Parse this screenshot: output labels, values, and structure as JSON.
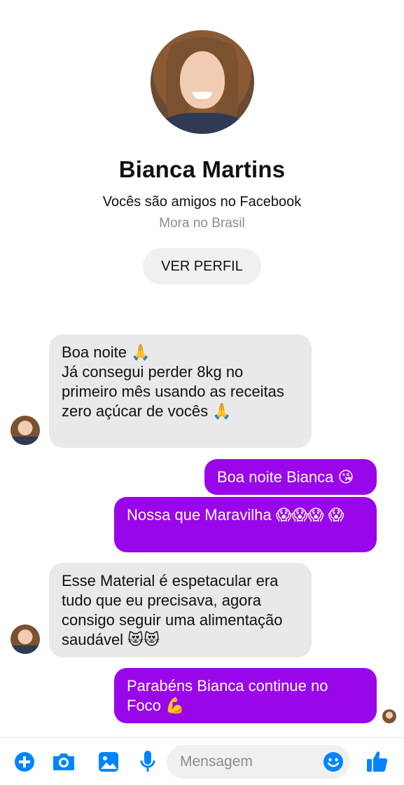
{
  "profile": {
    "name": "Bianca Martins",
    "subtitle": "Vocês são amigos no Facebook",
    "location": "Mora no Brasil",
    "view_profile_label": "VER PERFIL"
  },
  "messages": [
    {
      "direction": "incoming",
      "text": "Boa noite 🙏\nJá consegui perder 8kg no primeiro mês usando as receitas zero açúcar de vocês 🙏"
    },
    {
      "direction": "outgoing",
      "text": "Boa noite Bianca 😘"
    },
    {
      "direction": "outgoing",
      "text": "Nossa que Maravilha 😱😱😱 😱"
    },
    {
      "direction": "incoming",
      "text": "Esse Material é espetacular era tudo que eu precisava, agora consigo seguir uma alimentação saudável 😻😻"
    },
    {
      "direction": "outgoing",
      "text": "Parabéns Bianca continue no Foco 💪"
    }
  ],
  "composer": {
    "placeholder": "Mensagem",
    "icons": [
      "plus-icon",
      "camera-icon",
      "image-icon",
      "microphone-icon",
      "emoji-icon",
      "thumbs-up-icon"
    ]
  },
  "colors": {
    "accent": "#0084ff",
    "outgoing_bubble": "#9a06ea",
    "incoming_bubble": "#e9e9eb"
  }
}
